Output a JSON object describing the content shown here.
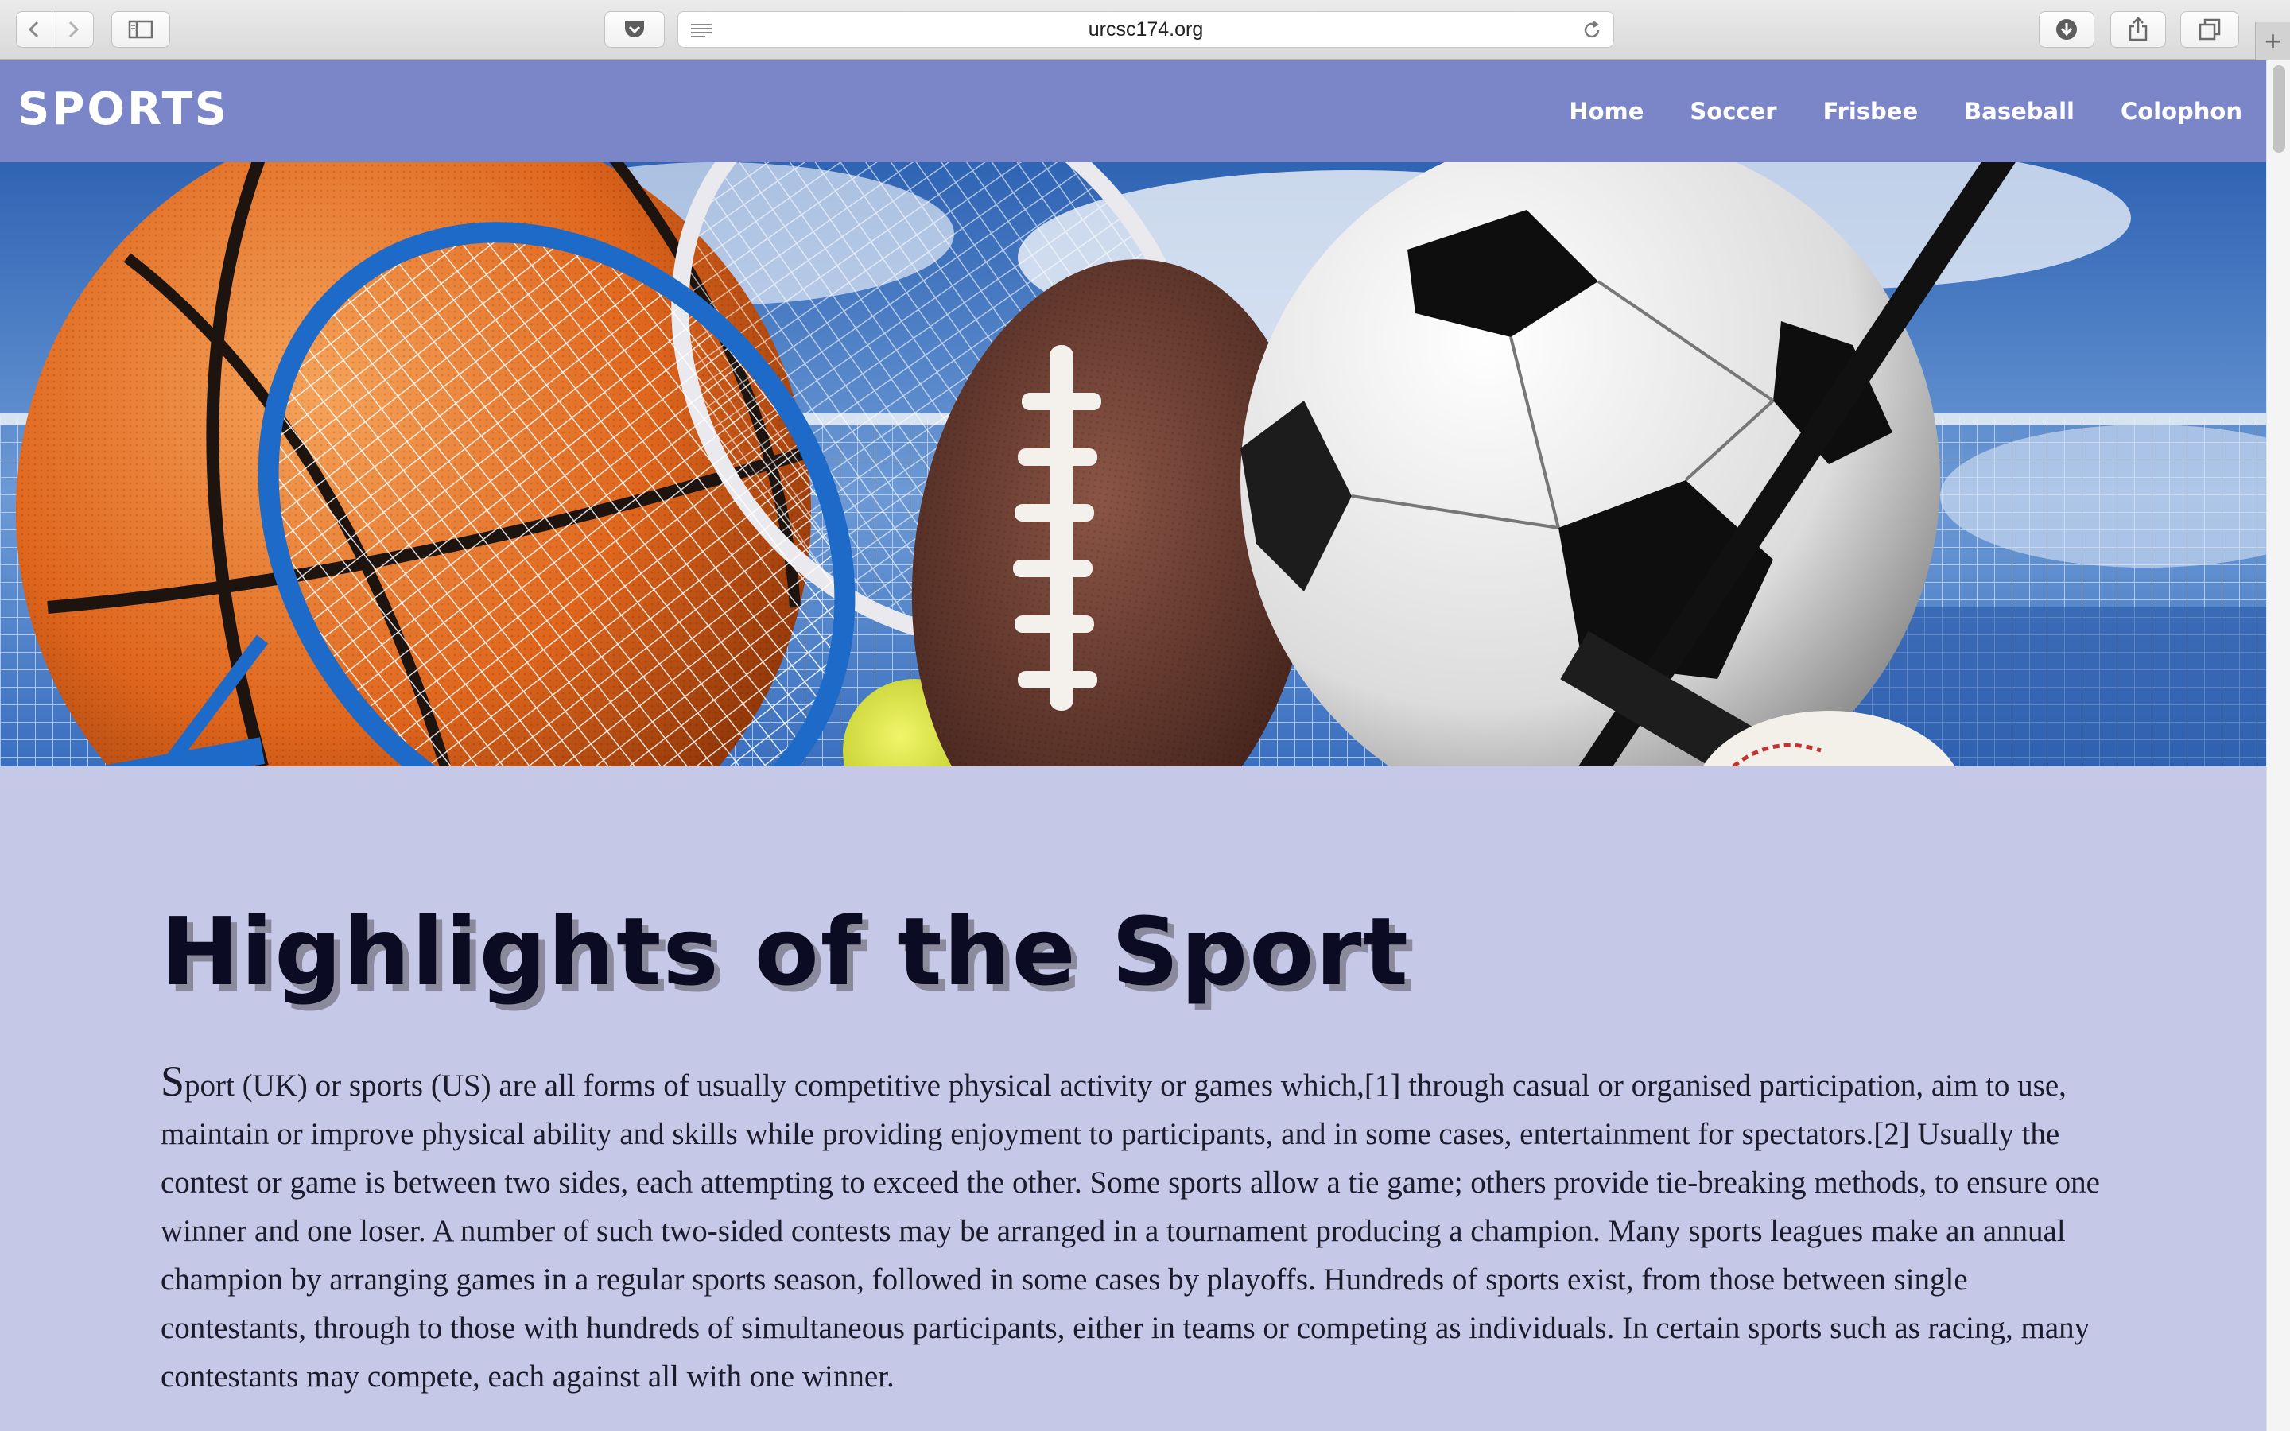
{
  "browser": {
    "url": "urcsc174.org",
    "icons": {
      "back": "chevron-left-icon",
      "forward": "chevron-right-icon",
      "sidebar": "sidebar-icon",
      "pocket": "pocket-icon",
      "reader": "reader-icon",
      "reload": "reload-icon",
      "downloads": "download-icon",
      "share": "share-icon",
      "tabs": "tabs-icon",
      "new_tab": "plus-icon"
    }
  },
  "site": {
    "logo": "SPORTS",
    "nav": [
      "Home",
      "Soccer",
      "Frisbee",
      "Baseball",
      "Colophon"
    ],
    "colors": {
      "nav_bg": "#7b86c9",
      "page_bg": "#c6c8e8",
      "title": "#0b0c24"
    }
  },
  "hero": {
    "image": "sports-balls-banner"
  },
  "main": {
    "title": "Highlights of the Sport",
    "intro_first_letter": "S",
    "intro_rest": "port (UK) or sports (US) are all forms of usually competitive physical activity or games which,[1] through casual or organised participation, aim to use, maintain or improve physical ability and skills while providing enjoyment to participants, and in some cases, entertainment for spectators.[2] Usually the contest or game is between two sides, each attempting to exceed the other. Some sports allow a tie game; others provide tie-breaking methods, to ensure one winner and one loser. A number of such two-sided contests may be arranged in a tournament producing a champion. Many sports leagues make an annual champion by arranging games in a regular sports season, followed in some cases by playoffs. Hundreds of sports exist, from those between single contestants, through to those with hundreds of simultaneous participants, either in teams or competing as individuals. In certain sports such as racing, many contestants may compete, each against all with one winner."
  }
}
